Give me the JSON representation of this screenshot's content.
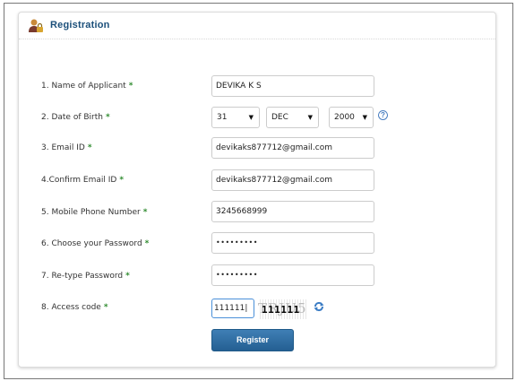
{
  "header": {
    "title": "Registration",
    "icon": "user-lock-icon"
  },
  "fields": {
    "name": {
      "label": "1. Name of Applicant",
      "value": "DEVIKA K S"
    },
    "dob": {
      "label": "2. Date of Birth",
      "day": "31",
      "month": "DEC",
      "year": "2000",
      "help": "?"
    },
    "email": {
      "label": "3. Email ID",
      "value": "devikaks877712@gmail.com"
    },
    "confirm_email": {
      "label": "4.Confirm Email ID",
      "value": "devikaks877712@gmail.com"
    },
    "mobile": {
      "label": "5. Mobile Phone Number",
      "value": "3245668999"
    },
    "password": {
      "label": "6. Choose your Password",
      "value": "•••••••••"
    },
    "retype_password": {
      "label": "7. Re-type Password",
      "value": "•••••••••"
    },
    "access_code": {
      "label": "8. Access code",
      "value": "111111|",
      "captcha": "111111",
      "captcha_ghost": "TRJU5"
    }
  },
  "required_mark": "*",
  "arrow": "▼",
  "register_label": "Register",
  "colors": {
    "title": "#1b4f7a",
    "required": "#2e8b2e",
    "button": "#2d6a9f"
  }
}
